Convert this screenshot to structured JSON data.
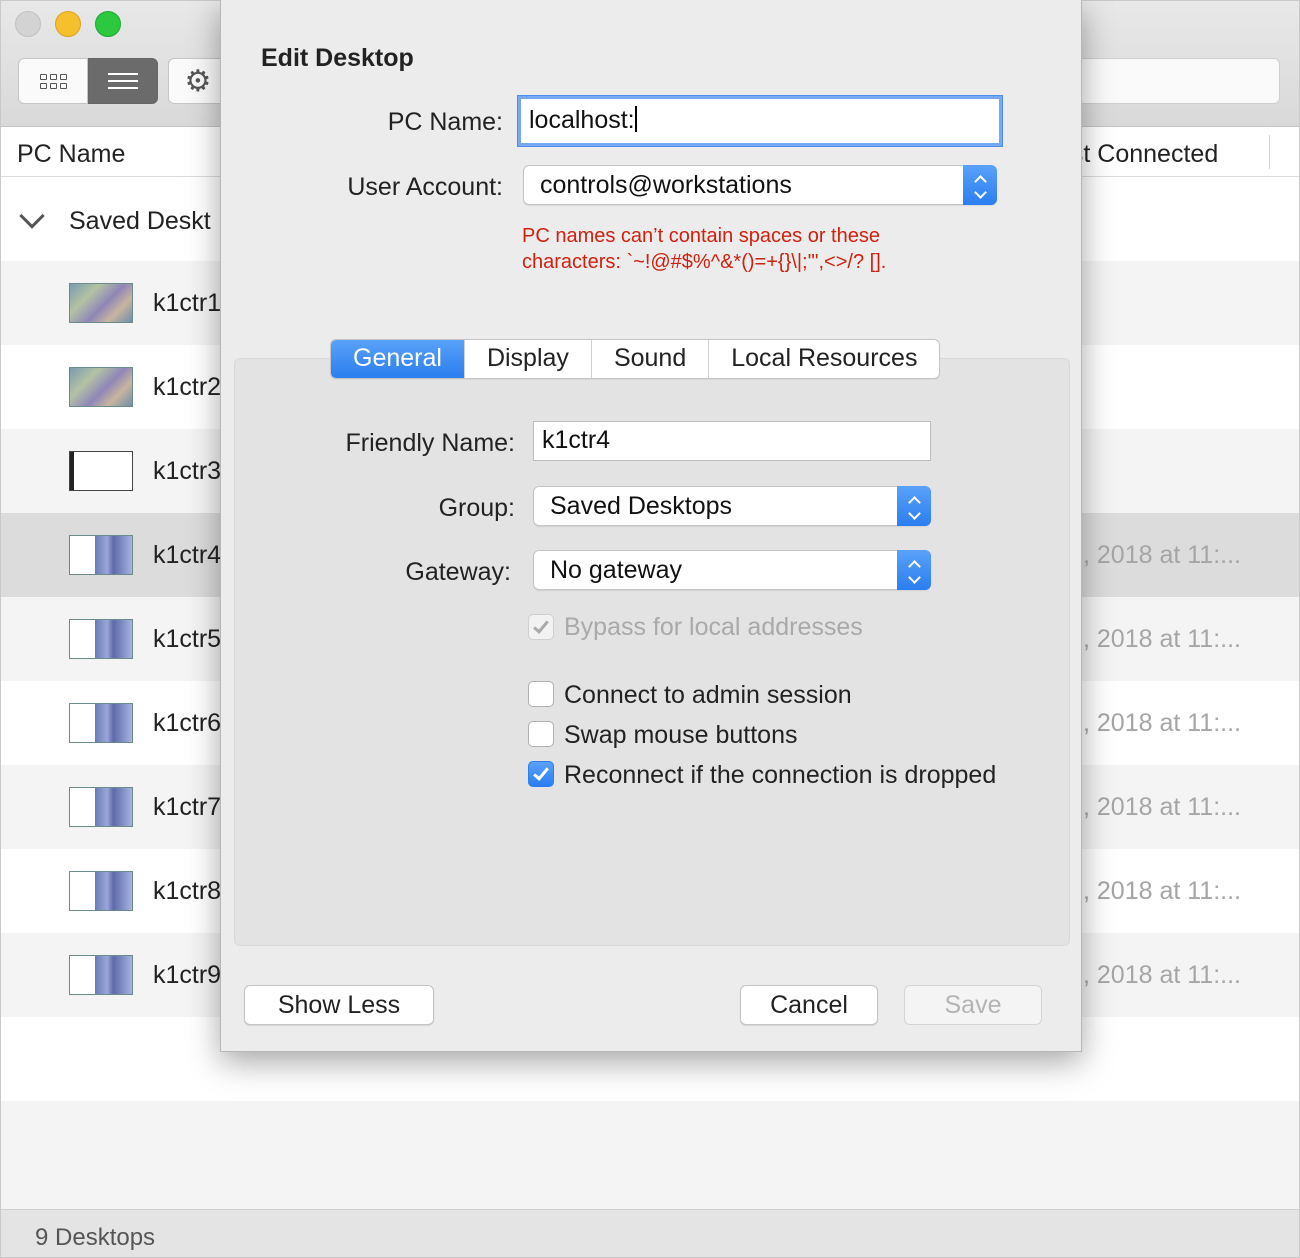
{
  "window": {
    "toolbar": {
      "grid_icon": "grid-icon",
      "list_icon": "list-icon",
      "gear_icon": "gear-icon"
    },
    "columns": {
      "pc_name": "PC Name",
      "last_connected": "ast Connected"
    },
    "group": {
      "label": "Saved Deskt"
    },
    "rows": [
      {
        "name": "k1ctr1",
        "date": ""
      },
      {
        "name": "k1ctr2",
        "date": ""
      },
      {
        "name": "k1ctr3",
        "date": ""
      },
      {
        "name": "k1ctr4",
        "date": ", 2018 at 11:..."
      },
      {
        "name": "k1ctr5",
        "date": ", 2018 at 11:..."
      },
      {
        "name": "k1ctr6",
        "date": ", 2018 at 11:..."
      },
      {
        "name": "k1ctr7",
        "date": ", 2018 at 11:..."
      },
      {
        "name": "k1ctr8",
        "date": ", 2018 at 11:..."
      },
      {
        "name": "k1ctr9",
        "date": ", 2018 at 11:..."
      }
    ],
    "status": "9 Desktops"
  },
  "dialog": {
    "title": "Edit Desktop",
    "pc_name_label": "PC Name:",
    "pc_name_value": "localhost:",
    "user_account_label": "User Account:",
    "user_account_value": "controls@workstations",
    "error_line1": "PC names can’t contain spaces or these",
    "error_line2": "characters: `~!@#$%^&*()=+{}\\|;'\",<>/? [].",
    "tabs": [
      "General",
      "Display",
      "Sound",
      "Local Resources"
    ],
    "friendly_name_label": "Friendly Name:",
    "friendly_name_value": "k1ctr4",
    "group_label": "Group:",
    "group_value": "Saved Desktops",
    "gateway_label": "Gateway:",
    "gateway_value": "No gateway",
    "checkboxes": {
      "bypass": "Bypass for local addresses",
      "admin": "Connect to admin session",
      "swap": "Swap mouse buttons",
      "reconnect": "Reconnect if the connection is dropped"
    },
    "buttons": {
      "show_less": "Show Less",
      "cancel": "Cancel",
      "save": "Save"
    }
  },
  "colors": {
    "accent": "#2a7ef0",
    "error": "#d0210f"
  }
}
